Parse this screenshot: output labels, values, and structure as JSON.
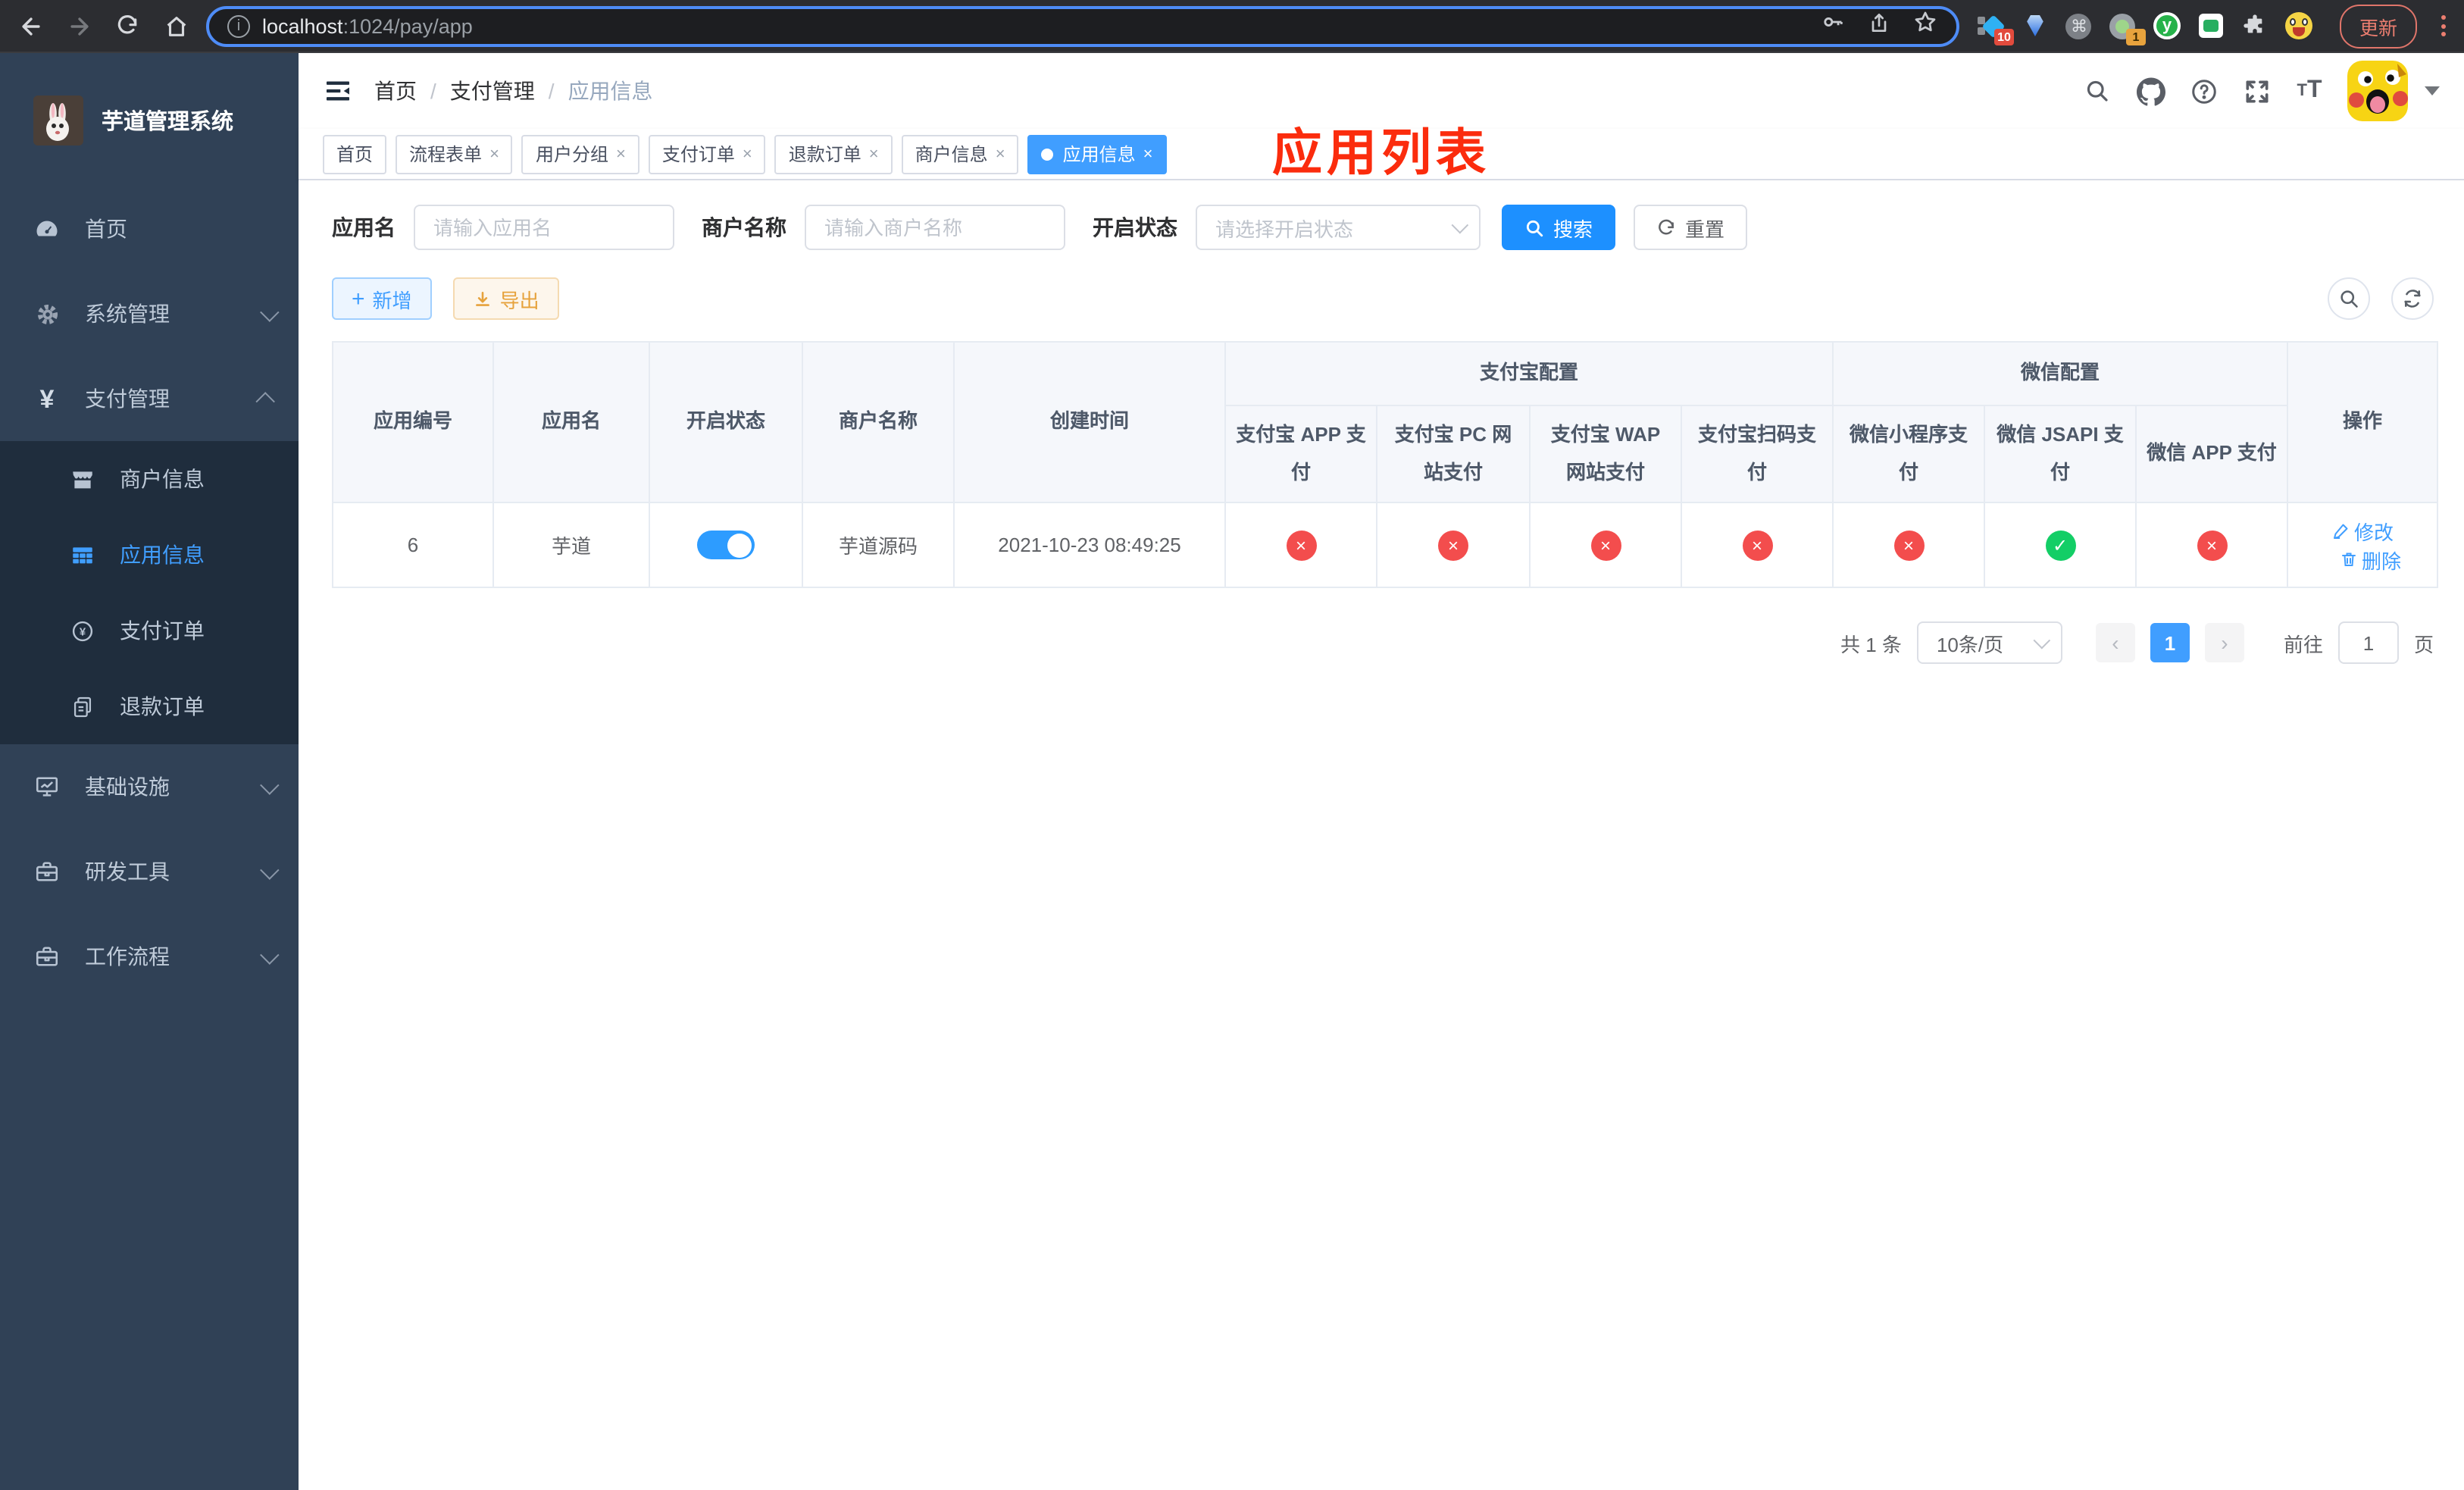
{
  "browser": {
    "url": {
      "host": "localhost",
      "path": ":1024/pay/app"
    },
    "update_label": "更新",
    "extension_badges": {
      "diamond": "10",
      "profile": "1"
    },
    "y_extension_letter": "y"
  },
  "sidebar": {
    "title": "芋道管理系统",
    "menu": [
      {
        "label": "首页"
      },
      {
        "label": "系统管理"
      },
      {
        "label": "支付管理"
      },
      {
        "label": "基础设施"
      },
      {
        "label": "研发工具"
      },
      {
        "label": "工作流程"
      }
    ],
    "submenu": [
      {
        "label": "商户信息"
      },
      {
        "label": "应用信息"
      },
      {
        "label": "支付订单"
      },
      {
        "label": "退款订单"
      }
    ]
  },
  "header": {
    "breadcrumb": {
      "home": "首页",
      "section": "支付管理",
      "current": "应用信息"
    },
    "annotation": "应用列表"
  },
  "tabs": [
    {
      "label": "首页"
    },
    {
      "label": "流程表单"
    },
    {
      "label": "用户分组"
    },
    {
      "label": "支付订单"
    },
    {
      "label": "退款订单"
    },
    {
      "label": "商户信息"
    },
    {
      "label": "应用信息"
    }
  ],
  "filters": {
    "app_name": {
      "label": "应用名",
      "placeholder": "请输入应用名"
    },
    "merchant_name": {
      "label": "商户名称",
      "placeholder": "请输入商户名称"
    },
    "status": {
      "label": "开启状态",
      "placeholder": "请选择开启状态"
    },
    "search": "搜索",
    "reset": "重置"
  },
  "toolbar": {
    "add": "新增",
    "export": "导出"
  },
  "table": {
    "headers": {
      "app_id": "应用编号",
      "app_name": "应用名",
      "status": "开启状态",
      "merchant_name": "商户名称",
      "create_time": "创建时间",
      "alipay_group": "支付宝配置",
      "wechat_group": "微信配置",
      "alipay_app": "支付宝 APP 支付",
      "alipay_pc": "支付宝 PC 网站支付",
      "alipay_wap": "支付宝 WAP 网站支付",
      "alipay_qr": "支付宝扫码支付",
      "wechat_lite": "微信小程序支付",
      "wechat_jsapi": "微信 JSAPI 支付",
      "wechat_app": "微信 APP 支付",
      "actions": "操作"
    },
    "row": {
      "app_id": "6",
      "app_name": "芋道",
      "status_enabled": true,
      "merchant_name": "芋道源码",
      "create_time": "2021-10-23 08:49:25",
      "channels": [
        false,
        false,
        false,
        false,
        false,
        true,
        false
      ],
      "edit": "修改",
      "delete": "删除"
    }
  },
  "pagination": {
    "total": "共 1 条",
    "page_size": "10条/页",
    "page": "1",
    "goto_label": "前往",
    "goto_value": "1",
    "unit": "页"
  },
  "colors": {
    "primary": "#409eff",
    "danger": "#f34d4d",
    "success": "#13ce66",
    "warning": "#e6a23c",
    "annotation": "#fb2c0d"
  }
}
